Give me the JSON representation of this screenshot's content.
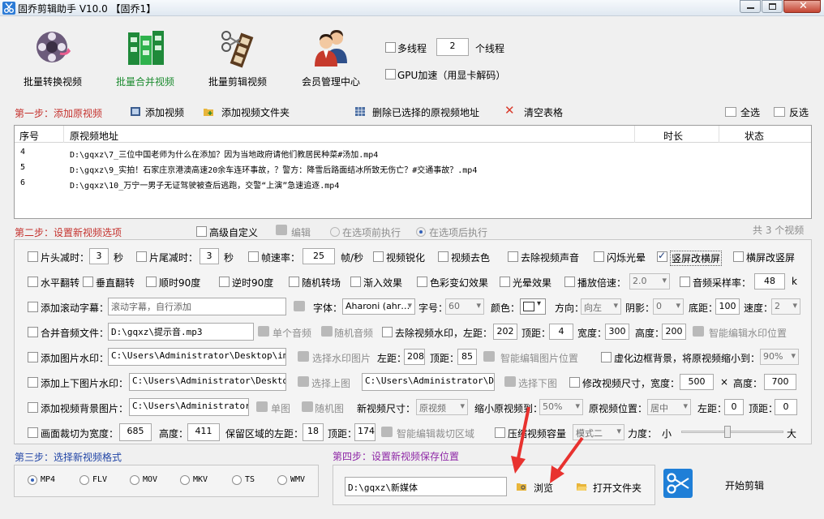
{
  "window": {
    "title": "固乔剪辑助手 V10.0  【固乔1】"
  },
  "toolbar": {
    "convert": "批量转换视频",
    "merge": "批量合并视频",
    "edit": "批量剪辑视频",
    "member": "会员管理中心",
    "multithread": "多线程",
    "thread_count": "2",
    "thread_unit": "个线程",
    "gpu": "GPU加速（用显卡解码）"
  },
  "step1": {
    "title": "第一步：添加原视频",
    "add_video": "添加视频",
    "add_folder": "添加视频文件夹",
    "delete_selected": "删除已选择的原视频地址",
    "clear_table": "清空表格",
    "select_all": "全选",
    "invert": "反选",
    "columns": [
      "序号",
      "原视频地址",
      "时长",
      "状态"
    ],
    "rows": [
      {
        "index": "4",
        "path": "D:\\gqxz\\7_三位中国老师为什么在添加？因为当地政府请他们教居民种菜#汤加.mp4"
      },
      {
        "index": "5",
        "path": "D:\\gqxz\\9_实拍！石家庄京港澳高速20余车连环事故，？警方：降雪后路面结冰所致无伤亡？#交通事故？.mp4"
      },
      {
        "index": "6",
        "path": "D:\\gqxz\\10_万宁一男子无证驾驶被查后逃跑，交警“上演”急速追逐.mp4"
      }
    ]
  },
  "step2": {
    "title": "第二步：设置新视频选项",
    "advanced": "高级自定义",
    "edit": "编辑",
    "before": "在选项前执行",
    "after": "在选项后执行",
    "count": "共 3 个视频",
    "r1": {
      "head_cut": "片头减时：",
      "head_val": "3",
      "sec1": "秒",
      "tail_cut": "片尾减时：",
      "tail_val": "3",
      "sec2": "秒",
      "fps": "帧速率：",
      "fps_val": "25",
      "fps_unit": "帧/秒",
      "sharpen": "视频锐化",
      "decolor": "视频去色",
      "remove_audio": "去除视频声音",
      "flash": "闪烁光晕",
      "v2h": "竖屏改横屏",
      "h2v": "横屏改竖屏"
    },
    "r2": {
      "hflip": "水平翻转",
      "vflip": "垂直翻转",
      "cw90": "顺时90度",
      "ccw90": "逆时90度",
      "random_trans": "随机转场",
      "fadein": "渐入效果",
      "color": "色彩变幻效果",
      "halo": "光晕效果",
      "speed": "播放倍速：",
      "speed_val": "2.0",
      "sample": "音频采样率：",
      "sample_val": "48",
      "k": "k"
    },
    "r3": {
      "scroll": "添加滚动字幕：",
      "scroll_placeholder": "滚动字幕，自行添加",
      "font": "字体：",
      "font_val": "Aharoni (ahr…",
      "size": "字号：",
      "size_val": "60",
      "color": "颜色：",
      "dir": "方向：",
      "dir_val": "向左",
      "shadow": "阴影：",
      "shadow_val": "0",
      "bottom": "底距：",
      "bottom_val": "100",
      "speed": "速度：",
      "speed_val": "2"
    },
    "r4": {
      "merge_audio": "合并音频文件：",
      "audio_path": "D:\\gqxz\\提示音.mp3",
      "single_audio": "单个音频",
      "random_audio": "随机音频",
      "remove_wm": "去除视频水印，左距：",
      "left_val": "202",
      "top": "顶距：",
      "top_val": "4",
      "width": "宽度：",
      "width_val": "300",
      "height": "高度：",
      "height_val": "200",
      "smart_wm": "智能编辑水印位置"
    },
    "r5": {
      "img_wm": "添加图片水印：",
      "img_path": "C:\\Users\\Administrator\\Desktop\\img-q",
      "choose_img": "选择水印图片",
      "left": "左距：",
      "left_val": "208",
      "top": "顶距：",
      "top_val": "85",
      "smart_img": "智能编辑图片位置",
      "blur_bg": "虚化边框背景，将原视频缩小到：",
      "blur_val": "90%"
    },
    "r6": {
      "tb_wm": "添加上下图片水印：",
      "top_path": "C:\\Users\\Administrator\\Desktop\\i",
      "choose_top": "选择上图",
      "bottom_path": "C:\\Users\\Administrator\\Desk",
      "choose_bottom": "选择下图",
      "resize": "修改视频尺寸，宽度：",
      "w_val": "500",
      "x": "×",
      "h": "高度：",
      "h_val": "700"
    },
    "r7": {
      "bg_img": "添加视频背景图片：",
      "bg_path": "C:\\Users\\Administrator\\D",
      "single": "单图",
      "random": "随机图",
      "new_size": "新视频尺寸：",
      "new_size_val": "原视频",
      "shrink": "缩小原视频到：",
      "shrink_val": "50%",
      "pos": "原视频位置：",
      "pos_val": "居中",
      "left": "左距：",
      "left_val": "0",
      "top": "顶距：",
      "top_val": "0"
    },
    "r8": {
      "crop": "画面裁切为宽度：",
      "crop_w": "685",
      "h": "高度：",
      "crop_h": "411",
      "keep_left": "保留区域的左距：",
      "keep_left_val": "18",
      "top": "顶距：",
      "top_val": "174",
      "smart_crop": "智能编辑裁切区域",
      "compress": "压缩视频容量",
      "mode_val": "模式二",
      "force": "力度：",
      "small": "小",
      "big": "大",
      "force_level": 0.45
    }
  },
  "step3": {
    "title": "第三步：选择新视频格式",
    "formats": [
      "MP4",
      "FLV",
      "MOV",
      "MKV",
      "TS",
      "WMV"
    ]
  },
  "step4": {
    "title": "第四步：设置新视频保存位置",
    "path": "D:\\gqxz\\新媒体",
    "browse": "浏览",
    "open_folder": "打开文件夹",
    "start": "开始剪辑"
  },
  "colors": {
    "step_red": "#c5322e",
    "step_blue": "#2145a6",
    "step_purple": "#8e27a6",
    "arrow": "#e8322f"
  }
}
